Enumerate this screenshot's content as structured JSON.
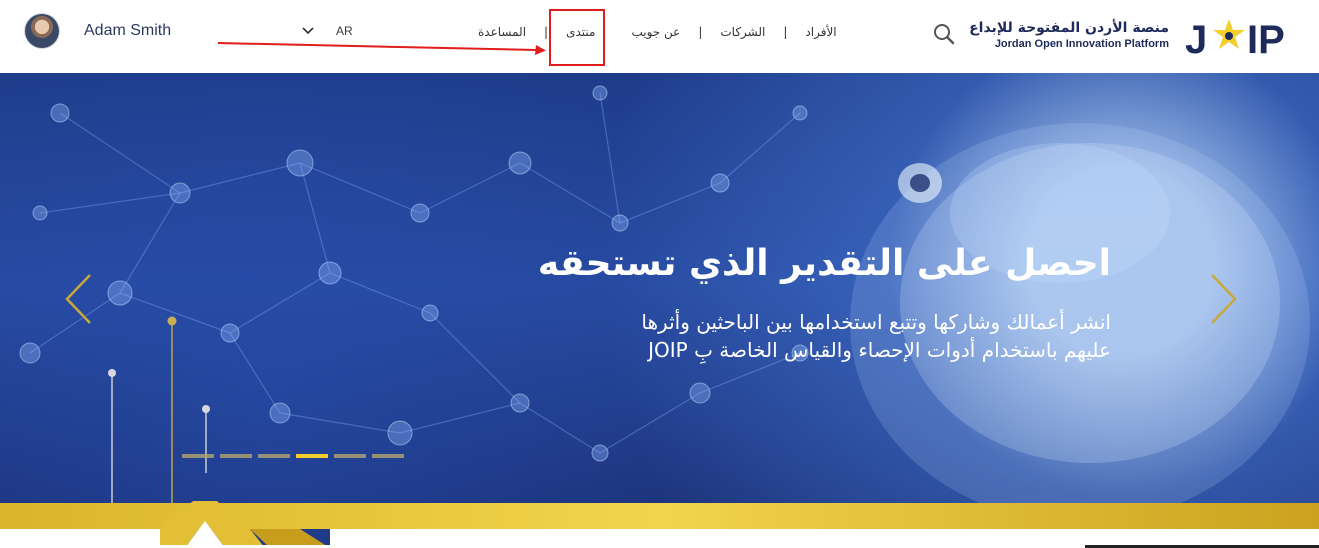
{
  "user": {
    "name": "Adam Smith"
  },
  "language": {
    "current": "AR"
  },
  "nav": {
    "items": [
      "الأفراد",
      "الشركات",
      "عن جويب",
      "منتدى",
      "المساعدة"
    ]
  },
  "brand": {
    "name_ar": "منصة الأردن المفتوحة للإبداع",
    "name_en": "Jordan Open Innovation Platform",
    "logo_text": "JOIP"
  },
  "hero": {
    "headline": "احصل على التقدير الذي تستحقه",
    "subline": "انشر أعمالك وشاركها وتتبع استخدامها بين الباحثين وأثرها عليهم باستخدام أدوات الإحصاء والقياس الخاصة بِ JOIP",
    "slide_count": 6,
    "active_slide": 4
  },
  "colors": {
    "accent_gold": "#f4cf2a",
    "brand_navy": "#1e2a5a",
    "highlight_red": "#e21d1d"
  },
  "icons": {
    "search": "search-icon",
    "chevron_down": "chevron-down-icon",
    "arrow_left": "chevron-left-icon",
    "arrow_right": "chevron-right-icon"
  }
}
